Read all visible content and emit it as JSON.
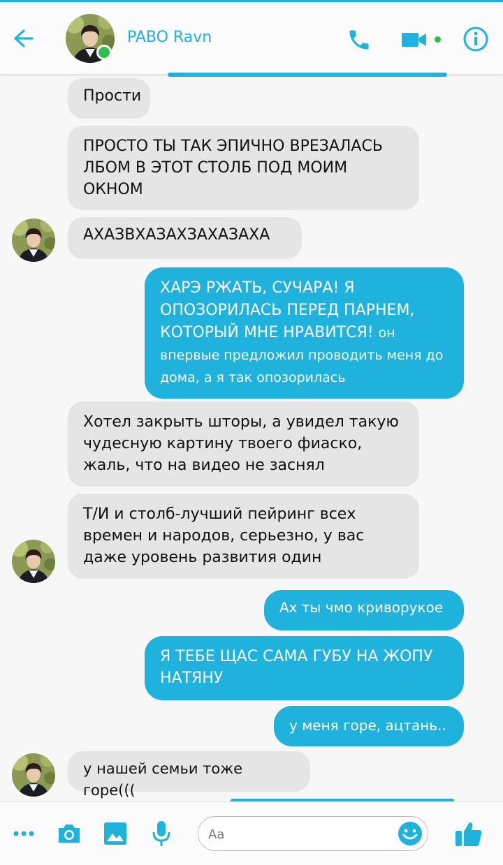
{
  "header": {
    "contact_name": "PABO Ravn",
    "status": "online",
    "icons": [
      "back-arrow-icon",
      "phone-icon",
      "video-camera-icon",
      "info-icon"
    ]
  },
  "messages": [
    {
      "side": "in",
      "text": "Прости"
    },
    {
      "side": "in",
      "text": "ПРОСТО ТЫ ТАК ЭПИЧНО ВРЕЗАЛАСЬ ЛБОМ В ЭТОТ СТОЛБ ПОД МОИМ ОКНОМ"
    },
    {
      "side": "in",
      "text": "АХАЗВХАЗАХЗАХАЗАХА"
    },
    {
      "side": "out",
      "text_main": "ХАРЭ РЖАТЬ, СУЧАРА! Я ОПОЗОРИЛАСЬ ПЕРЕД ПАРНЕМ, КОТОРЫЙ МНЕ НРАВИТСЯ!",
      "text_tail": "он впервые предложил проводить меня до дома, а я так опозорилась"
    },
    {
      "side": "in",
      "text": "Хотел закрыть шторы, а увидел такую чудесную картину твоего фиаско, жаль, что на видео не заснял"
    },
    {
      "side": "in",
      "text": "Т/И и столб-лучший пейринг всех времен и народов, серьезно, у вас даже уровень развития один"
    },
    {
      "side": "out",
      "text": "Ах ты чмо криворукое"
    },
    {
      "side": "out",
      "text": "Я ТЕБЕ ЩАС САМА ГУБУ НА ЖОПУ НАТЯНУ"
    },
    {
      "side": "out",
      "text": "у меня горе, ацтань.."
    },
    {
      "side": "in",
      "text": "у нашей семьи тоже горе((("
    }
  ],
  "composer": {
    "placeholder": "Aa",
    "icons": [
      "more-icon",
      "camera-icon",
      "gallery-icon",
      "microphone-icon",
      "emoji-icon",
      "thumbs-up-icon"
    ]
  },
  "colors": {
    "accent": "#1fb2dc",
    "incoming_bubble": "#e5e5e5",
    "online": "#2fbf4f"
  }
}
